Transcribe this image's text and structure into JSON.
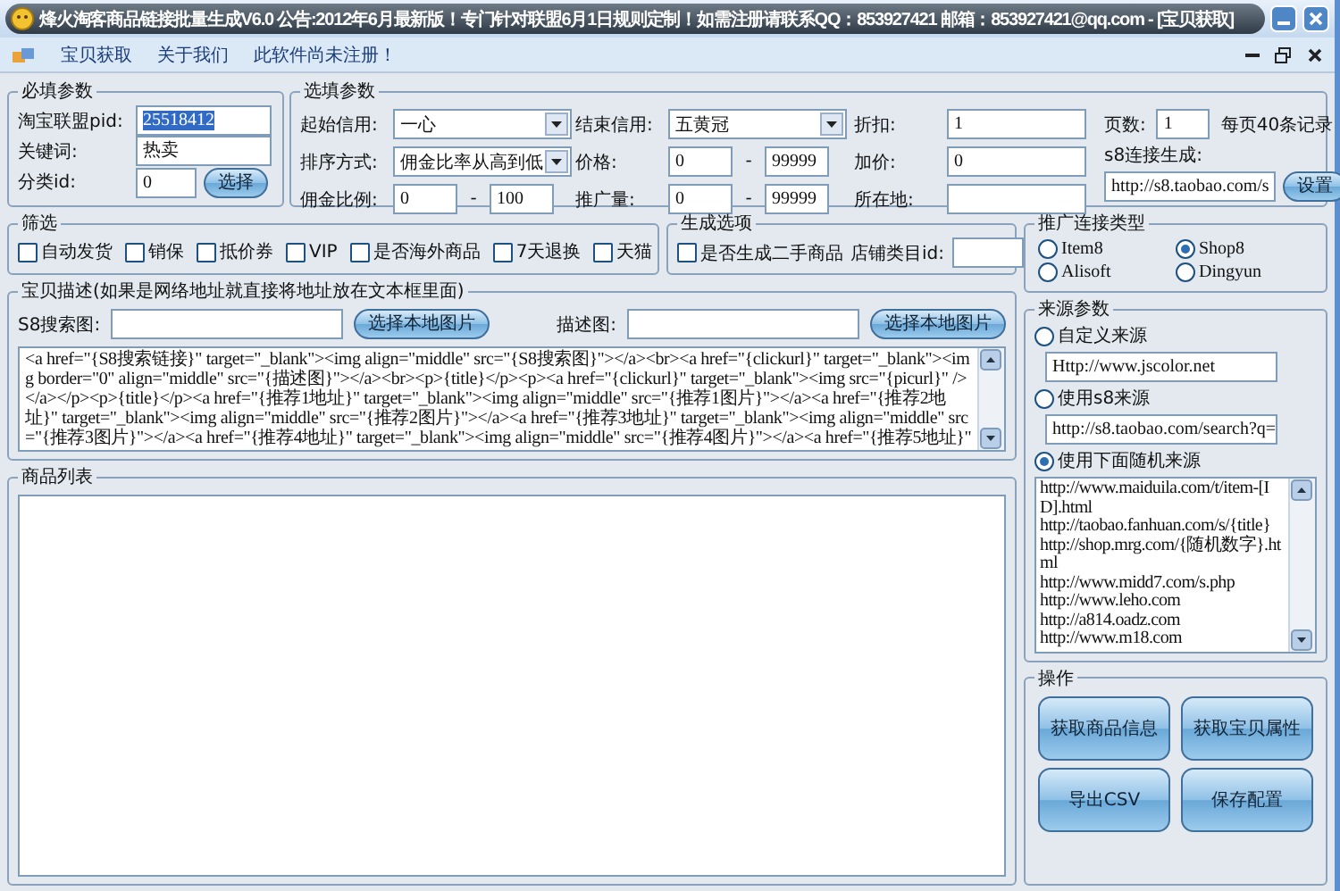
{
  "window": {
    "title": "烽火淘客商品链接批量生成V6.0 公告:2012年6月最新版！专门针对联盟6月1日规则定制！如需注册请联系QQ：853927421 邮箱：853927421@qq.com - [宝贝获取]"
  },
  "menu": [
    {
      "label": "宝贝获取"
    },
    {
      "label": "关于我们"
    },
    {
      "label": "此软件尚未注册！"
    }
  ],
  "required": {
    "title": "必填参数",
    "button": "选择",
    "fields": [
      {
        "label": "淘宝联盟pid:",
        "value": "25518412",
        "highlighted": true
      },
      {
        "label": "关键词:",
        "value": "热卖",
        "highlighted": false
      },
      {
        "label": "分类id:",
        "value": "0",
        "highlighted": false
      }
    ]
  },
  "optional": {
    "title": "选填参数",
    "fields": [
      {
        "label": "起始信用:",
        "kind": "select",
        "value": "一心"
      },
      {
        "label": "结束信用:",
        "kind": "select",
        "value": "五黄冠"
      },
      {
        "label": "折扣:",
        "kind": "text",
        "value": "1"
      },
      {
        "label": "排序方式:",
        "kind": "select",
        "value": "佣金比率从高到低"
      },
      {
        "label": "价格:",
        "kind": "range",
        "from": "0",
        "separator": "-",
        "to": "99999"
      },
      {
        "label": "加价:",
        "kind": "text",
        "value": "0"
      },
      {
        "label": "佣金比例:",
        "kind": "range",
        "from": "0",
        "separator": "-",
        "to": "100"
      },
      {
        "label": "推广量:",
        "kind": "range",
        "from": "0",
        "separator": "-",
        "to": "99999"
      },
      {
        "label": "所在地:",
        "kind": "text"
      }
    ],
    "pages": {
      "label": "页数:",
      "value": "1",
      "note": "每页40条记录"
    },
    "s8_link": {
      "label": "s8连接生成:",
      "value": "http://s8.taobao.com/s",
      "button": "设置"
    }
  },
  "filter": {
    "title": "筛选",
    "options": [
      {
        "label": "自动发货",
        "checked": false
      },
      {
        "label": "销保",
        "checked": false
      },
      {
        "label": "抵价券",
        "checked": false
      },
      {
        "label": "VIP",
        "checked": false
      },
      {
        "label": "是否海外商品",
        "checked": false
      },
      {
        "label": "7天退换",
        "checked": false
      },
      {
        "label": "天猫",
        "checked": false
      }
    ]
  },
  "generate": {
    "title": "生成选项",
    "option": {
      "label": "是否生成二手商品",
      "checked": false
    },
    "field_label": "店铺类目id:"
  },
  "description": {
    "title": "宝贝描述(如果是网络地址就直接将地址放在文本框里面)",
    "s8_image_label": "S8搜索图:",
    "s8_image_button": "选择本地图片",
    "desc_image_label": "描述图:",
    "desc_image_button": "选择本地图片",
    "template": "<a href=\"{S8搜索链接}\"  target=\"_blank\"><img align=\"middle\" src=\"{S8搜索图}\"></a><br><a href=\"{clickurl}\" target=\"_blank\"><img border=\"0\" align=\"middle\" src=\"{描述图}\"></a><br><p>{title}</p><p><a href=\"{clickurl}\" target=\"_blank\"><img src=\"{picurl}\" /></a></p><p>{title}</p><a href=\"{推荐1地址}\"  target=\"_blank\"><img align=\"middle\" src=\"{推荐1图片}\"></a><a href=\"{推荐2地址}\"  target=\"_blank\"><img align=\"middle\" src=\"{推荐2图片}\"></a><a href=\"{推荐3地址}\"  target=\"_blank\"><img align=\"middle\" src=\"{推荐3图片}\"></a><a href=\"{推荐4地址}\"  target=\"_blank\"><img align=\"middle\" src=\"{推荐4图片}\"></a><a href=\"{推荐5地址}\""
  },
  "products": {
    "title": "商品列表"
  },
  "link_type": {
    "title": "推广连接类型",
    "options": [
      {
        "label": "Item8",
        "selected": false
      },
      {
        "label": "Shop8",
        "selected": true
      },
      {
        "label": "Alisoft",
        "selected": false
      },
      {
        "label": "Dingyun",
        "selected": false
      }
    ]
  },
  "source": {
    "title": "来源参数",
    "options": [
      {
        "label": "自定义来源",
        "selected": false,
        "url": "Http://www.jscolor.net"
      },
      {
        "label": "使用s8来源",
        "selected": false,
        "url": "http://s8.taobao.com/search?q="
      },
      {
        "label": "使用下面随机来源",
        "selected": true
      }
    ],
    "random_sources": [
      "http://www.maiduila.com/t/item-[ID].html",
      "http://taobao.fanhuan.com/s/{title}",
      "http://shop.mrg.com/{随机数字}.html",
      "http://www.midd7.com/s.php",
      "http://www.leho.com",
      "http://a814.oadz.com",
      "http://www.m18.com"
    ]
  },
  "actions": {
    "title": "操作",
    "buttons": [
      "获取商品信息",
      "获取宝贝属性",
      "导出CSV",
      "保存配置"
    ]
  }
}
